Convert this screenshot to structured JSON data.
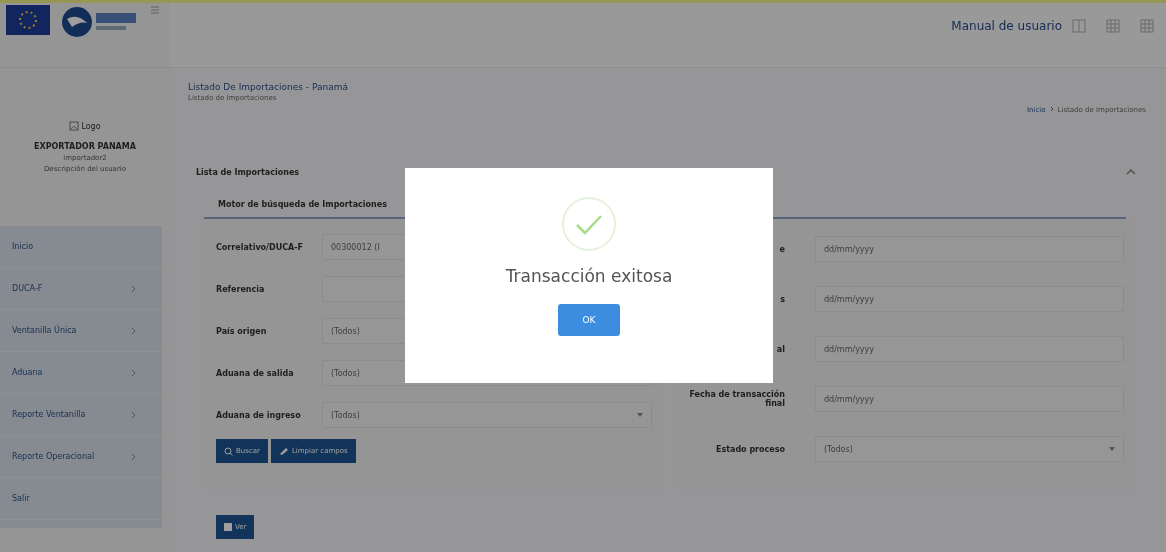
{
  "header": {
    "manual_link": "Manual de usuario"
  },
  "sidebar": {
    "logo_alt": "Logo",
    "user_name": "EXPORTADOR PANAMA",
    "user_login": "importador2",
    "user_description": "Descripción del usuario",
    "items": [
      {
        "label": "Inicio",
        "has_children": false
      },
      {
        "label": "DUCA-F",
        "has_children": true
      },
      {
        "label": "Ventanilla Única",
        "has_children": true
      },
      {
        "label": "Aduana",
        "has_children": true
      },
      {
        "label": "Reporte Ventanilla",
        "has_children": true
      },
      {
        "label": "Reporte Operacional",
        "has_children": true
      },
      {
        "label": "Salir",
        "has_children": false
      }
    ]
  },
  "page": {
    "title": "Listado De Importaciones - Panamá",
    "subtitle": "Listado de Importaciones",
    "breadcrumb": [
      {
        "label": "Inicio",
        "link": true
      },
      {
        "label": "Listado de Importaciones",
        "link": false
      }
    ]
  },
  "card": {
    "title": "Lista de Importaciones",
    "expanded": true,
    "tab": "Motor de búsqueda de Importaciones",
    "left_fields": [
      {
        "label": "Correlativo/DUCA-F",
        "kind": "text",
        "value": "00300012 (I"
      },
      {
        "label": "Referencia",
        "kind": "text"
      },
      {
        "label": "País origen",
        "kind": "select",
        "value": "(Todos)"
      },
      {
        "label": "Aduana de salida",
        "kind": "select",
        "value": "(Todos)"
      },
      {
        "label": "Aduana de ingreso",
        "kind": "select",
        "value": "(Todos)"
      }
    ],
    "right_fields": [
      {
        "label": "e",
        "kind": "text",
        "placeholder": "dd/mm/yyyy"
      },
      {
        "label": "s",
        "kind": "text",
        "placeholder": "dd/mm/yyyy"
      },
      {
        "label": "al",
        "kind": "text",
        "placeholder": "dd/mm/yyyy"
      },
      {
        "label": "Fecha de transacción final",
        "kind": "text",
        "placeholder": "dd/mm/yyyy"
      },
      {
        "label": "Estado proceso",
        "kind": "select",
        "value": "(Todos)"
      }
    ],
    "buttons": [
      {
        "label": "Buscar"
      },
      {
        "label": "Limpiar campos"
      }
    ],
    "view_button": {
      "label": "Ver"
    }
  },
  "modal": {
    "title": "Transacción exitosa",
    "button": "OK"
  }
}
